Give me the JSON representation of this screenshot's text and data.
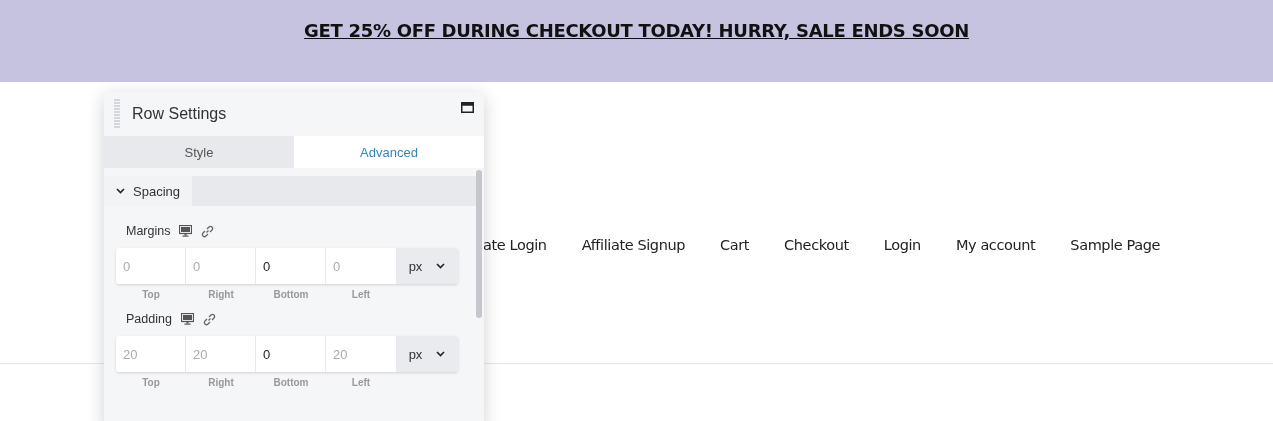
{
  "banner": {
    "text": "GET 25% OFF DURING CHECKOUT TODAY! HURRY, SALE ENDS SOON"
  },
  "nav": {
    "items": [
      "ate Login",
      "Affiliate Signup",
      "Cart",
      "Checkout",
      "Login",
      "My account",
      "Sample Page"
    ]
  },
  "panel": {
    "title": "Row Settings",
    "tabs": [
      {
        "label": "Style",
        "selected": false
      },
      {
        "label": "Advanced",
        "selected": true
      }
    ],
    "section": {
      "title": "Spacing",
      "expanded": true
    },
    "groups": [
      {
        "label": "Margins",
        "fields": [
          {
            "placeholder": "0"
          },
          {
            "placeholder": "0"
          },
          {
            "value": "0"
          },
          {
            "placeholder": "0"
          }
        ],
        "unit": "px",
        "sides": [
          "Top",
          "Right",
          "Bottom",
          "Left"
        ]
      },
      {
        "label": "Padding",
        "fields": [
          {
            "placeholder": "20"
          },
          {
            "placeholder": "20"
          },
          {
            "value": "0"
          },
          {
            "placeholder": "20"
          }
        ],
        "unit": "px",
        "sides": [
          "Top",
          "Right",
          "Bottom",
          "Left"
        ]
      }
    ]
  }
}
